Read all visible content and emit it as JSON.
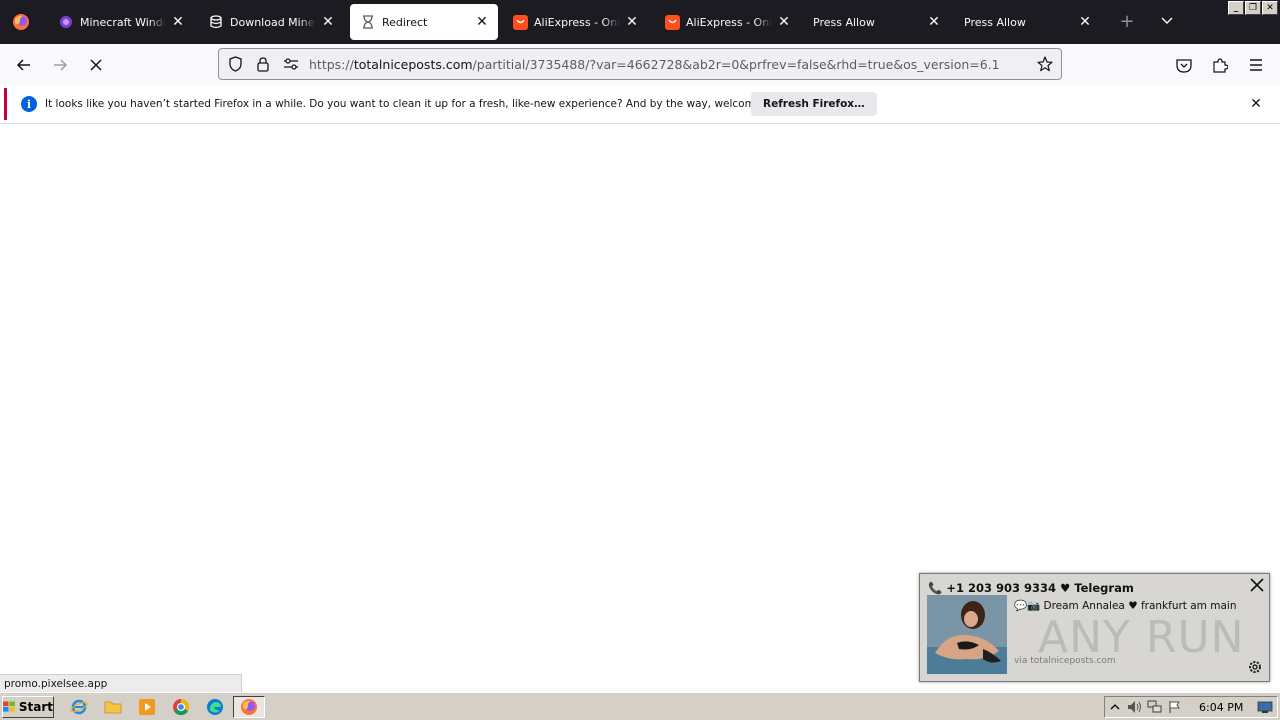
{
  "browser": {
    "tabs": [
      {
        "title": "Minecraft Windows",
        "icon": "minecraft-purple-icon",
        "active": false
      },
      {
        "title": "Download Minecraft",
        "icon": "database-icon",
        "active": false
      },
      {
        "title": "Redirect",
        "icon": "hourglass-icon",
        "active": true
      },
      {
        "title": "AliExpress - Online S",
        "icon": "aliexpress-icon",
        "active": false
      },
      {
        "title": "AliExpress - Online S",
        "icon": "aliexpress-icon",
        "active": false
      },
      {
        "title": "Press Allow",
        "icon": "",
        "active": false
      },
      {
        "title": "Press Allow",
        "icon": "",
        "active": false
      }
    ],
    "url": {
      "prefix": "https://",
      "host": "totalniceposts.com",
      "path": "/partitial/3735488/?var=4662728&ab2r=0&prfrev=false&rhd=true&os_version=6.1"
    }
  },
  "notification": {
    "message": "It looks like you haven’t started Firefox in a while. Do you want to clean it up for a fresh, like-new experience? And by the way, welcome back!",
    "button_label": "Refresh Firefox…",
    "accent": "#c50042"
  },
  "popup": {
    "phone_line": "📞 +1 203 903 9334 ♥ Telegram",
    "subtitle": "💬📷 Dream Annalea ♥ frankfurt am main",
    "via": "via totalniceposts.com"
  },
  "watermark": "ANY RUN",
  "status_text": "promo.pixelsee.app",
  "taskbar": {
    "start_label": "Start",
    "clock": "6:04 PM"
  }
}
